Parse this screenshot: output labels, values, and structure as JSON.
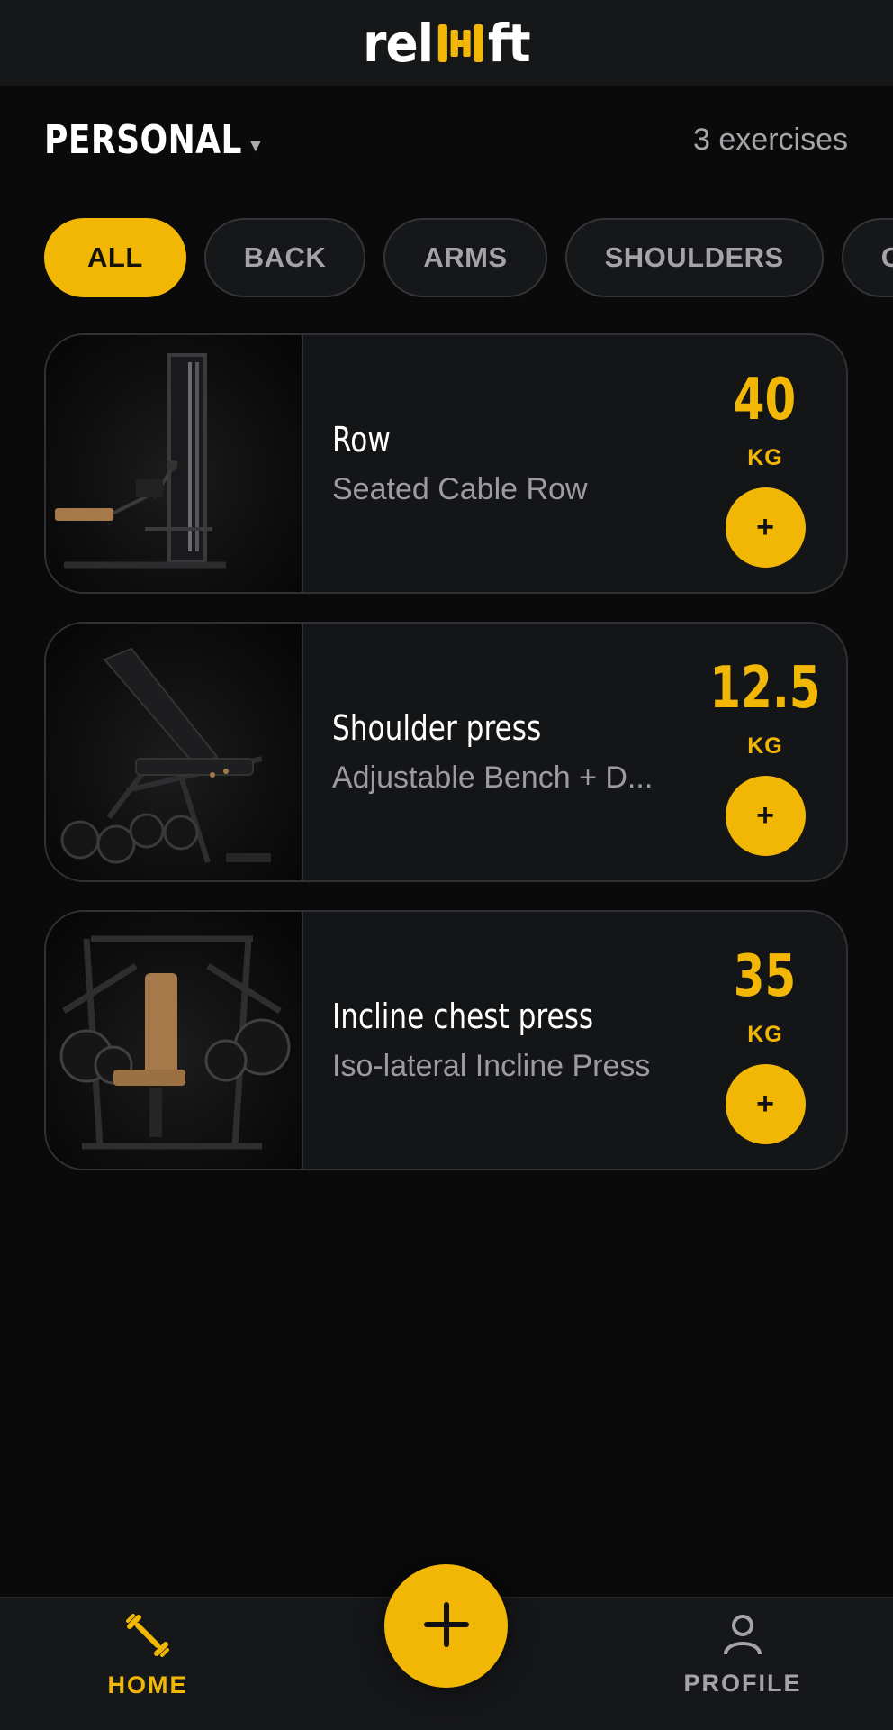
{
  "app": {
    "logo_prefix": "rel",
    "logo_suffix": "ft",
    "brand_color": "#f2b705"
  },
  "header": {
    "collection": "PERSONAL",
    "exercise_count": "3 exercises"
  },
  "filters": [
    {
      "label": "ALL",
      "active": true
    },
    {
      "label": "BACK",
      "active": false
    },
    {
      "label": "ARMS",
      "active": false
    },
    {
      "label": "SHOULDERS",
      "active": false
    },
    {
      "label": "CH",
      "active": false
    }
  ],
  "exercises": [
    {
      "name": "Row",
      "equipment": "Seated Cable Row",
      "weight": "40",
      "unit": "KG",
      "add_label": "+"
    },
    {
      "name": "Shoulder press",
      "equipment": "Adjustable Bench + D...",
      "weight": "12.5",
      "unit": "KG",
      "add_label": "+"
    },
    {
      "name": "Incline chest press",
      "equipment": "Iso-lateral Incline Press",
      "weight": "35",
      "unit": "KG",
      "add_label": "+"
    }
  ],
  "nav": {
    "home": "HOME",
    "profile": "PROFILE",
    "add_icon": "plus-icon"
  }
}
